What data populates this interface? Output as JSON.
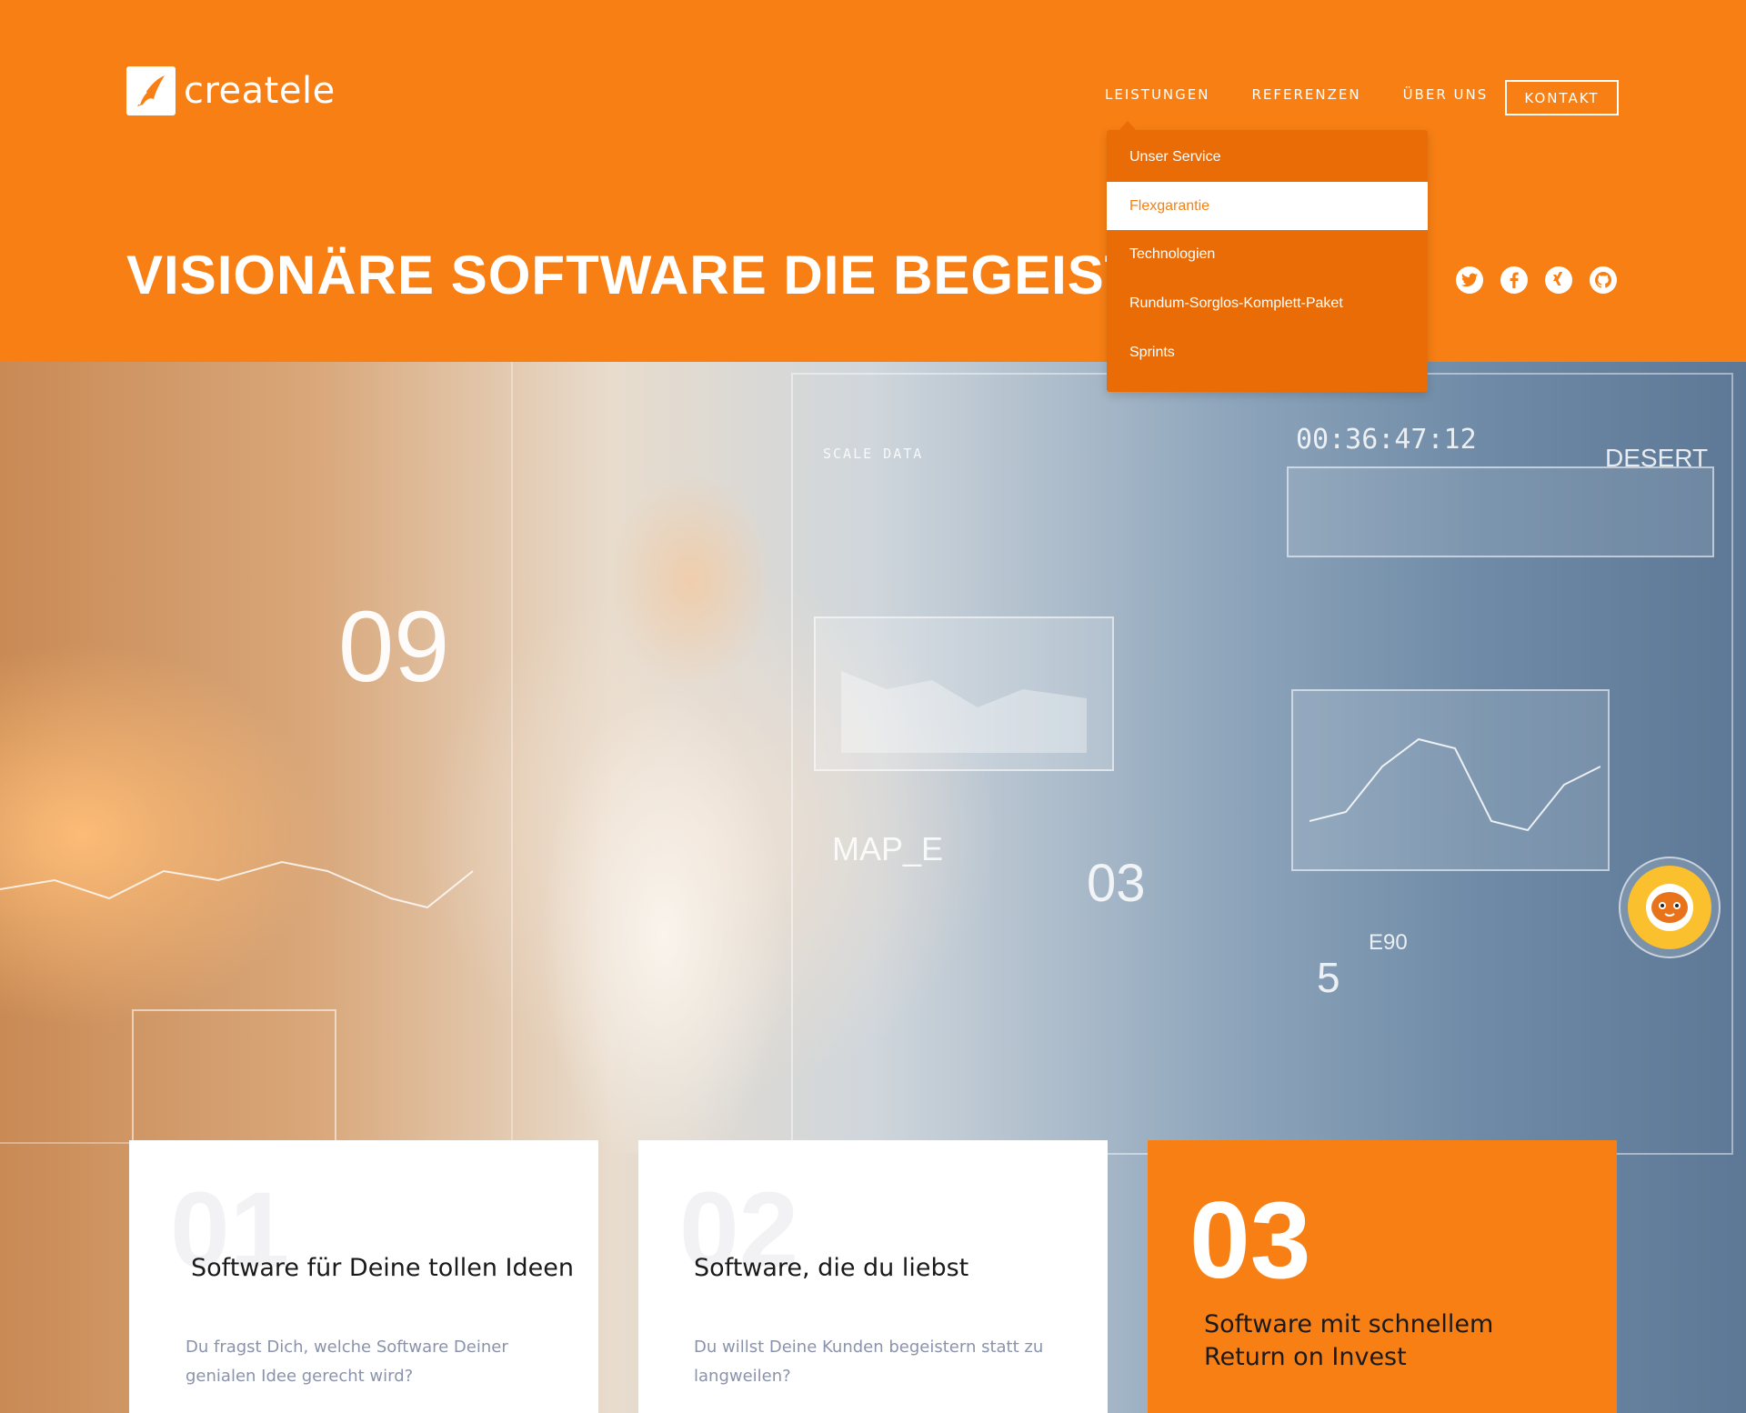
{
  "brand": {
    "name": "createle"
  },
  "nav": {
    "items": [
      {
        "label": "LEISTUNGEN"
      },
      {
        "label": "REFERENZEN"
      },
      {
        "label": "ÜBER UNS"
      }
    ],
    "contact_label": "KONTAKT"
  },
  "dropdown": {
    "items": [
      {
        "label": "Unser Service"
      },
      {
        "label": "Flexgarantie"
      },
      {
        "label": "Technologien"
      },
      {
        "label": "Rundum-Sorglos-Komplett-Paket"
      },
      {
        "label": "Sprints"
      }
    ],
    "active": "Flexgarantie"
  },
  "hero": {
    "headline": "VISIONÄRE SOFTWARE DIE BEGEISTERT"
  },
  "socials": [
    {
      "icon": "twitter-icon",
      "glyph": "t"
    },
    {
      "icon": "facebook-icon",
      "glyph": "f"
    },
    {
      "icon": "xing-icon",
      "glyph": "x"
    },
    {
      "icon": "github-icon",
      "glyph": "g"
    }
  ],
  "hero_overlay": {
    "timer": "00:36:47:12",
    "desert": "DESERT",
    "scale": "SCALE DATA",
    "big_num": "09",
    "map": "MAP_E",
    "three": "03",
    "five": "5",
    "e90": "E90"
  },
  "cards": [
    {
      "number": "01",
      "title": "Software für Deine tollen Ideen",
      "text": "Du fragst Dich, welche Software Deiner genialen Idee gerecht wird?"
    },
    {
      "number": "02",
      "title": "Software, die du liebst",
      "text": "Du willst Deine Kunden begeistern statt zu langweilen?"
    },
    {
      "number": "03",
      "title": "Software mit schnellem Return on Invest",
      "text": ""
    }
  ],
  "colors": {
    "brand_orange": "#f77f14",
    "dropdown_orange": "#ea6c06",
    "text_muted": "#8a93ab"
  }
}
